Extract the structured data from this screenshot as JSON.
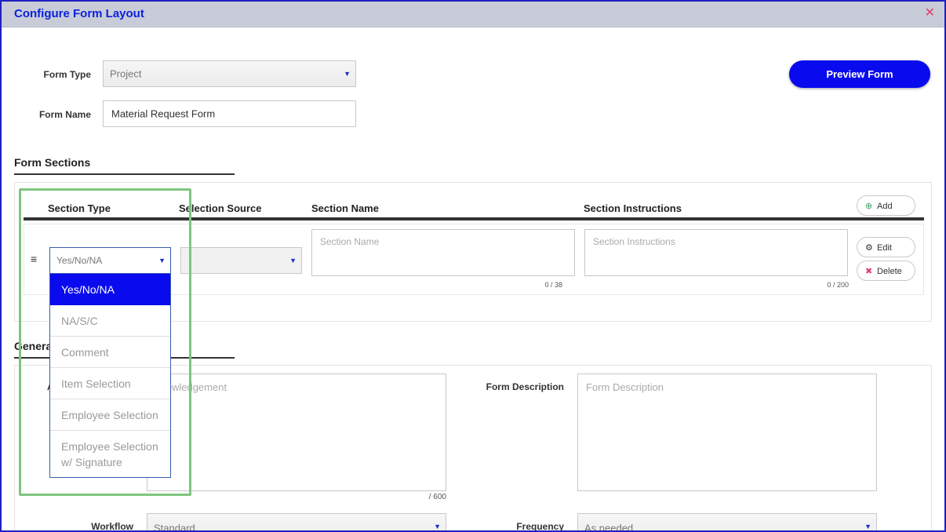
{
  "modal": {
    "title": "Configure Form Layout",
    "close_glyph": "✕"
  },
  "form": {
    "type_label": "Form Type",
    "type_value": "Project",
    "name_label": "Form Name",
    "name_value": "Material Request Form",
    "preview_button": "Preview Form"
  },
  "sections": {
    "title": "Form Sections",
    "columns": {
      "section_type": "Section Type",
      "selection_source": "Selection Source",
      "section_name": "Section Name",
      "section_instructions": "Section Instructions"
    },
    "add_button": "Add",
    "row": {
      "section_type_value": "Yes/No/NA",
      "section_name_placeholder": "Section Name",
      "section_name_counter": "0 / 38",
      "instructions_placeholder": "Section Instructions",
      "instructions_counter": "0 / 200",
      "edit_button": "Edit",
      "delete_button": "Delete"
    },
    "type_options": [
      "Yes/No/NA",
      "NA/S/C",
      "Comment",
      "Item Selection",
      "Employee Selection",
      "Employee Selection w/ Signature"
    ]
  },
  "general": {
    "title_visible": "Genera",
    "ack_placeholder_visible": "knowledgement",
    "ack_counter": "/ 600",
    "ack_label_visible": "A",
    "description_label": "Form Description",
    "description_placeholder": "Form Description",
    "workflow_label": "Workflow",
    "workflow_value": "Standard",
    "frequency_label": "Frequency",
    "frequency_value": "As needed"
  },
  "colors": {
    "accent": "#0a0aee",
    "title_blue": "#0a1fe0",
    "titlebar": "#c8ccd8",
    "highlight": "#7fc57f"
  }
}
